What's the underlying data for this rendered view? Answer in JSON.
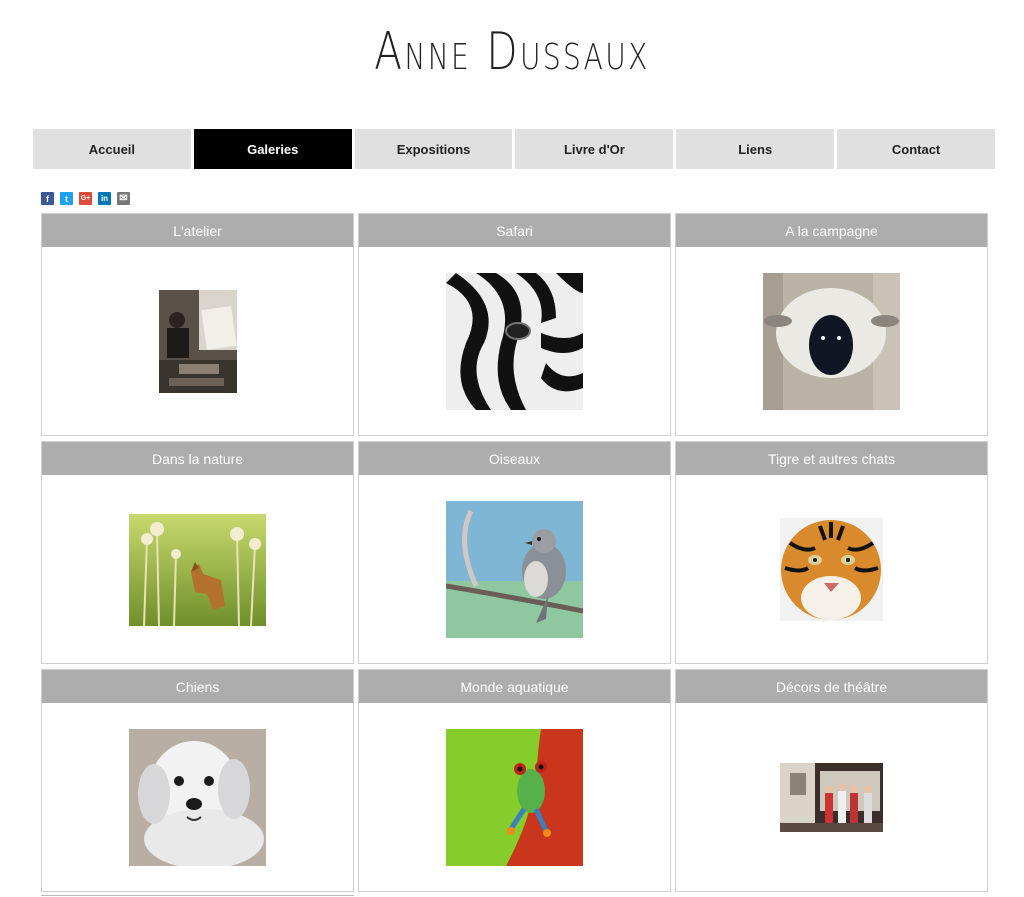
{
  "site": {
    "title": "Anne Dussaux"
  },
  "nav": {
    "items": [
      {
        "label": "Accueil",
        "active": false
      },
      {
        "label": "Galeries",
        "active": true
      },
      {
        "label": "Expositions",
        "active": false
      },
      {
        "label": "Livre d'Or",
        "active": false
      },
      {
        "label": "Liens",
        "active": false
      },
      {
        "label": "Contact",
        "active": false
      }
    ]
  },
  "share": {
    "icons": [
      {
        "name": "facebook-icon",
        "glyph": "f",
        "color": "#3b5998"
      },
      {
        "name": "twitter-icon",
        "glyph": "t",
        "color": "#1da1f2"
      },
      {
        "name": "google-plus-icon",
        "glyph": "G+",
        "color": "#dd4b39"
      },
      {
        "name": "linkedin-icon",
        "glyph": "in",
        "color": "#0077b5"
      },
      {
        "name": "email-icon",
        "glyph": "✉",
        "color": "#777777"
      }
    ]
  },
  "galleries": [
    {
      "title": "L'atelier",
      "image": "artist-studio-photo"
    },
    {
      "title": "Safari",
      "image": "zebra-painting"
    },
    {
      "title": "A la campagne",
      "image": "sheep-painting"
    },
    {
      "title": "Dans la nature",
      "image": "fox-in-meadow-painting"
    },
    {
      "title": "Oiseaux",
      "image": "bird-on-branch-painting"
    },
    {
      "title": "Tigre et autres chats",
      "image": "tiger-painting"
    },
    {
      "title": "Chiens",
      "image": "white-dog-painting"
    },
    {
      "title": "Monde aquatique",
      "image": "tree-frog-painting"
    },
    {
      "title": "Décors de théâtre",
      "image": "theatre-stage-photo"
    }
  ]
}
